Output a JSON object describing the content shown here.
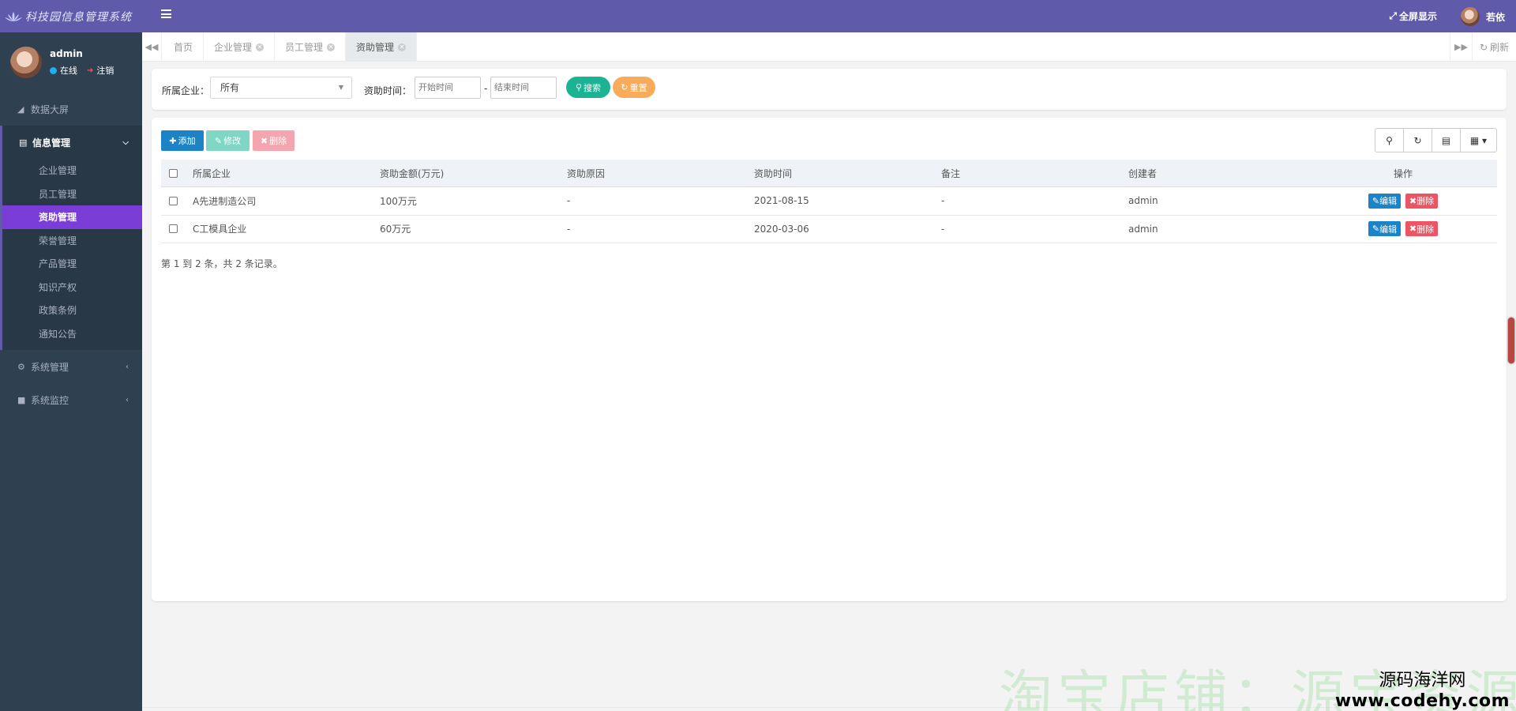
{
  "app": {
    "title": "科技园信息管理系统"
  },
  "user": {
    "name": "admin",
    "status": "在线",
    "logout": "注销",
    "top_name": "若依"
  },
  "header": {
    "fullscreen": "全屏显示"
  },
  "sidebar": {
    "dashboard": "数据大屏",
    "info_group": "信息管理",
    "items": [
      "企业管理",
      "员工管理",
      "资助管理",
      "荣誉管理",
      "产品管理",
      "知识产权",
      "政策条例",
      "通知公告"
    ],
    "system_mgmt": "系统管理",
    "system_monitor": "系统监控"
  },
  "tabs": [
    {
      "label": "首页"
    },
    {
      "label": "企业管理"
    },
    {
      "label": "员工管理"
    },
    {
      "label": "资助管理"
    }
  ],
  "tabbar": {
    "refresh": "刷新"
  },
  "search": {
    "company_label": "所属企业：",
    "company_value": "所有",
    "time_label": "资助时间：",
    "start_placeholder": "开始时间",
    "end_placeholder": "结束时间",
    "dash": "-",
    "search_btn": "搜索",
    "reset_btn": "重置"
  },
  "toolbar": {
    "add": "添加",
    "edit": "修改",
    "delete": "删除"
  },
  "table": {
    "columns": [
      "所属企业",
      "资助金额(万元)",
      "资助原因",
      "资助时间",
      "备注",
      "创建者",
      "操作"
    ],
    "rows": [
      {
        "company": "A先进制造公司",
        "amount": "100万元",
        "reason": "-",
        "date": "2021-08-15",
        "note": "-",
        "creator": "admin"
      },
      {
        "company": "C工模具企业",
        "amount": "60万元",
        "reason": "-",
        "date": "2020-03-06",
        "note": "-",
        "creator": "admin"
      }
    ],
    "row_edit": "编辑",
    "row_delete": "删除",
    "pager": "第 1 到 2 条，共 2 条记录。"
  },
  "watermark": {
    "text": "淘宝店铺：源宝资源",
    "site_name": "源码海洋网",
    "site_url": "www.codehy.com"
  },
  "colors": {
    "purple": "#5f5aa9",
    "sidebar": "#2f4050",
    "active": "#7a3dd8",
    "primary": "#1c84c6",
    "teal": "#1ab394",
    "orange": "#f8ac59",
    "danger": "#ed5565"
  }
}
